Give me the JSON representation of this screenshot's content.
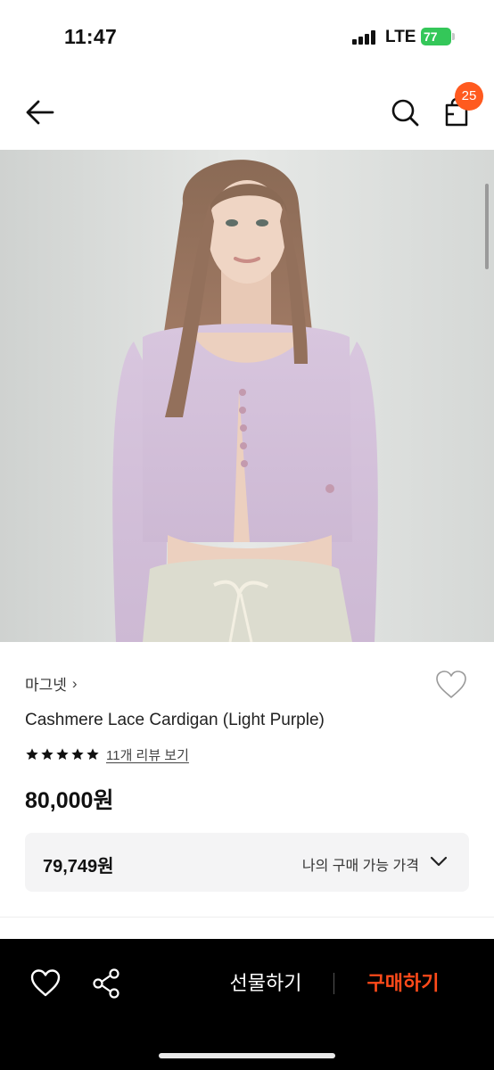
{
  "status_bar": {
    "time": "11:47",
    "network": "LTE",
    "battery": "77"
  },
  "header": {
    "back_icon": "arrow-left-icon",
    "search_icon": "search-icon",
    "cart_icon": "shopping-bag-icon",
    "cart_count": "25"
  },
  "product": {
    "brand": "마그넷",
    "brand_chevron": "›",
    "name": "Cashmere Lace Cardigan (Light Purple)",
    "rating_stars": 5,
    "review_link": "11개 리뷰 보기",
    "price": "80,000원",
    "my_price": {
      "value": "79,749원",
      "label": "나의 구매 가능 가격"
    }
  },
  "action_bar": {
    "wish_icon": "heart-icon",
    "share_icon": "share-icon",
    "gift_label": "선물하기",
    "buy_label": "구매하기"
  },
  "colors": {
    "badge": "#ff5a1f",
    "buy": "#ff4a1a",
    "battery": "#34c759",
    "action_bar_bg": "#000000",
    "price_box_bg": "#f4f4f5"
  }
}
